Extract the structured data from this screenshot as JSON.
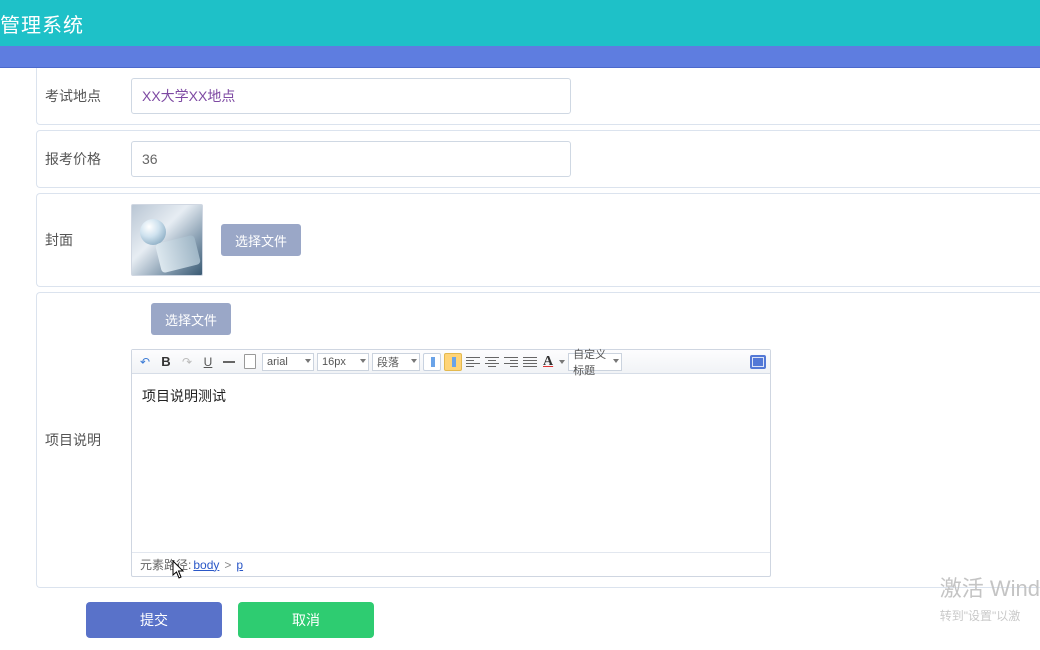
{
  "header": {
    "title": "管理系统"
  },
  "form": {
    "location": {
      "label": "考试地点",
      "value": "XX大学XX地点"
    },
    "price": {
      "label": "报考价格",
      "value": "36"
    },
    "cover": {
      "label": "封面",
      "choose": "选择文件"
    },
    "desc": {
      "label": "项目说明",
      "choose": "选择文件",
      "content": "项目说明测试"
    }
  },
  "editor": {
    "font_family": "arial",
    "font_size": "16px",
    "paragraph": "段落",
    "custom_title": "自定义标题",
    "path_label": "元素路径:",
    "path_body": "body",
    "path_p": "p"
  },
  "actions": {
    "submit": "提交",
    "cancel": "取消"
  },
  "watermark": {
    "title": "激活 Wind",
    "sub": "转到\"设置\"以激"
  }
}
